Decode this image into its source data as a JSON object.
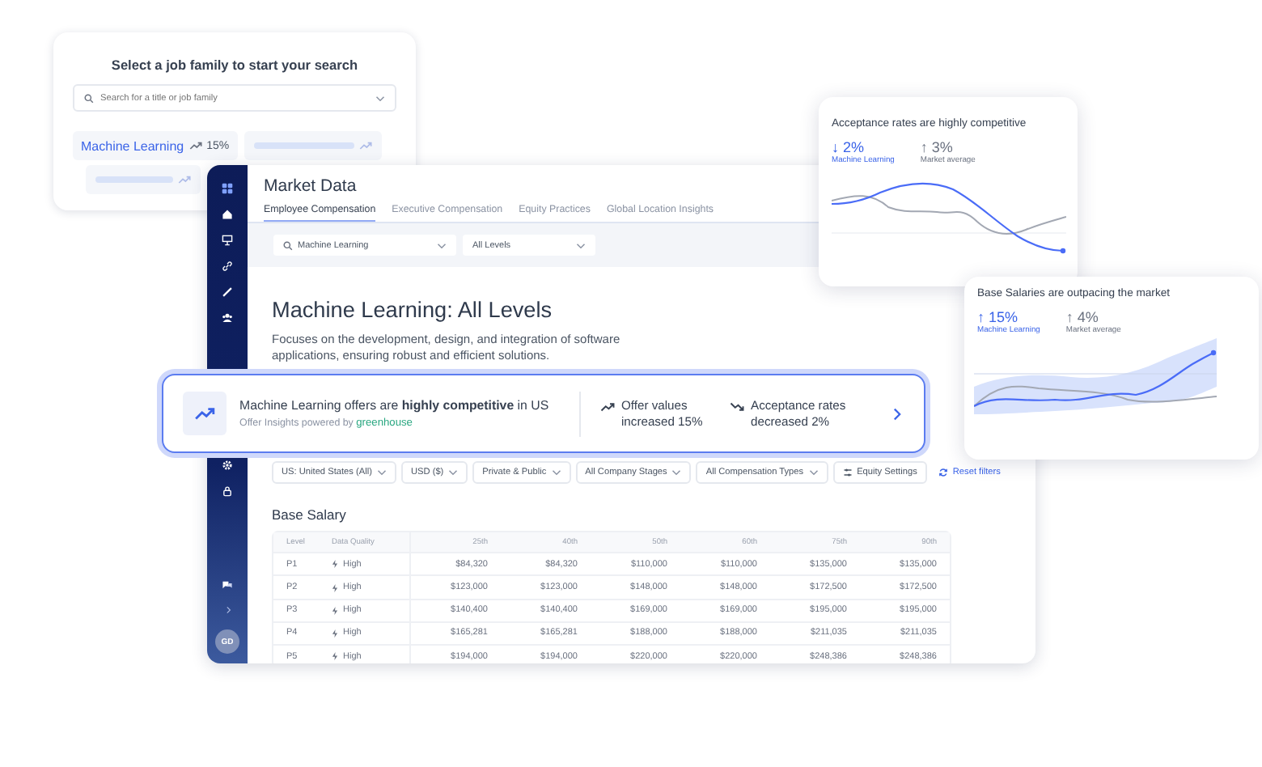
{
  "job_search_card": {
    "title": "Select a job family to start your search",
    "search": {
      "placeholder": "Search for a title or job family"
    },
    "suggestion": {
      "label": "Machine Learning",
      "change": "15%"
    }
  },
  "main_window": {
    "title": "Market Data",
    "tabs": [
      {
        "label": "Employee Compensation",
        "selected": true
      },
      {
        "label": "Executive Compensation",
        "selected": false
      },
      {
        "label": "Equity Practices",
        "selected": false
      },
      {
        "label": "Global Location Insights",
        "selected": false
      }
    ],
    "job_filter": {
      "value": "Machine Learning"
    },
    "level_filter": {
      "value": "All Levels"
    },
    "heading": "Machine Learning: All Levels",
    "description": "Focuses on the development, design, and integration of software applications, ensuring robust and efficient solutions.",
    "filters": [
      "US: United States (All)",
      "USD ($)",
      "Private & Public",
      "All Company Stages",
      "All Compensation Types"
    ],
    "equity_button": "Equity Settings",
    "reset_button": "Reset filters",
    "table": {
      "title": "Base Salary",
      "columns": [
        "Level",
        "Data Quality",
        "25th",
        "40th",
        "50th",
        "60th",
        "75th",
        "90th"
      ],
      "rows": [
        {
          "level": "P1",
          "quality": "High",
          "values": [
            "$84,320",
            "$84,320",
            "$110,000",
            "$110,000",
            "$135,000",
            "$135,000"
          ]
        },
        {
          "level": "P2",
          "quality": "High",
          "values": [
            "$123,000",
            "$123,000",
            "$148,000",
            "$148,000",
            "$172,500",
            "$172,500"
          ]
        },
        {
          "level": "P3",
          "quality": "High",
          "values": [
            "$140,400",
            "$140,400",
            "$169,000",
            "$169,000",
            "$195,000",
            "$195,000"
          ]
        },
        {
          "level": "P4",
          "quality": "High",
          "values": [
            "$165,281",
            "$165,281",
            "$188,000",
            "$188,000",
            "$211,035",
            "$211,035"
          ]
        },
        {
          "level": "P5",
          "quality": "High",
          "values": [
            "$194,000",
            "$194,000",
            "$220,000",
            "$220,000",
            "$248,386",
            "$248,386"
          ]
        }
      ]
    },
    "user_initials": "GD"
  },
  "insight_banner": {
    "text": "Machine Learning offers are **highly competitive** in US",
    "source": "Offer Insights powered by",
    "brand": "greenhouse",
    "stats": [
      {
        "kind": "up",
        "text": "Offer values increased 15%"
      },
      {
        "kind": "down",
        "text": "Acceptance rates decreased 2%"
      }
    ]
  },
  "trend_cards": [
    {
      "kind": "line",
      "title": "Acceptance rates are highly competitive",
      "primary": {
        "value": "↓ 2%",
        "label": "Machine Learning"
      },
      "market": {
        "value": "↑ 3%",
        "label": "Market average"
      }
    },
    {
      "kind": "band",
      "title": "Base Salaries are outpacing the market",
      "primary": {
        "value": "↑ 15%",
        "label": "Machine Learning"
      },
      "market": {
        "value": "↑ 4%",
        "label": "Market average"
      }
    }
  ]
}
